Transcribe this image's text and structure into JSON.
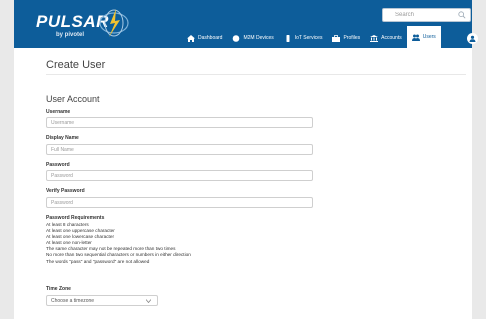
{
  "colors": {
    "header_bg": "#0d5d9a",
    "accent": "#0d5d9a",
    "page_bg": "#e9e9e9",
    "content_bg": "#ffffff"
  },
  "brand": {
    "name": "PULSAR",
    "tagline": "by pivotel",
    "logo_icon": "pulsar-swirl-icon"
  },
  "search": {
    "placeholder": "Search",
    "icon": "search-icon"
  },
  "nav": {
    "items": [
      {
        "label": "Dashboard",
        "icon": "home-icon",
        "active": false
      },
      {
        "label": "M2M Devices",
        "icon": "globe-icon",
        "active": false
      },
      {
        "label": "IoT Services",
        "icon": "phone-icon",
        "active": false
      },
      {
        "label": "Profiles",
        "icon": "briefcase-icon",
        "active": false
      },
      {
        "label": "Accounts",
        "icon": "bank-icon",
        "active": false
      },
      {
        "label": "Users",
        "icon": "users-icon",
        "active": true
      }
    ],
    "profile_icon": "user-circle-icon"
  },
  "page": {
    "title": "Create User",
    "section_title": "User Account",
    "fields": {
      "username": {
        "label": "Username",
        "placeholder": "Username",
        "value": ""
      },
      "display_name": {
        "label": "Display Name",
        "placeholder": "Full Name",
        "value": ""
      },
      "password": {
        "label": "Password",
        "placeholder": "Password",
        "value": ""
      },
      "verify_password": {
        "label": "Verify Password",
        "placeholder": "Password",
        "value": ""
      }
    },
    "requirements": {
      "title": "Password Requirements",
      "items": [
        "At least 8 characters",
        "At least one uppercase character",
        "At least one lowercase character",
        "At least one non-letter",
        "The same character may not be repeated more than two times",
        "No more than two sequential characters or numbers in either direction",
        "The words \"pass\" and \"password\" are not allowed"
      ]
    },
    "timezone": {
      "label": "Time Zone",
      "placeholder": "Choose a timezone"
    }
  }
}
